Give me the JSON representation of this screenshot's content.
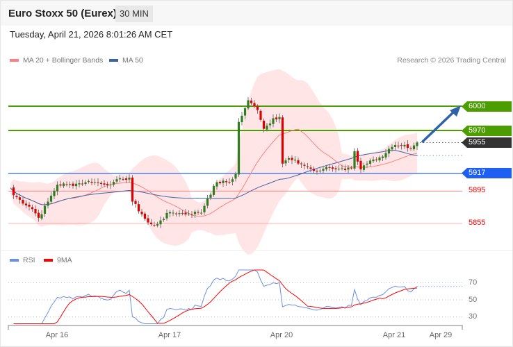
{
  "header": {
    "title": "Euro Stoxx 50 (Eurex)",
    "timeframe": "30 MIN",
    "datetime": "Tuesday, April 21, 2026 8:01:26 AM CET"
  },
  "legend": {
    "ma20": "MA 20 + Bollinger Bands",
    "ma50": "MA 50",
    "credit": "Research © 2026 Trading Central",
    "rsi": "RSI",
    "rsi_ma": "9MA"
  },
  "colors": {
    "up": "#2e7d1e",
    "down": "#e00000",
    "ma20": "#ff8080",
    "ma50": "#3a64a8",
    "band": "#ffe0e0",
    "resistance": "#4c9d00",
    "support": "#1e5ef0",
    "current": "#333333",
    "rsi": "#6b8ee8",
    "rsi_ma": "#ff0000"
  },
  "levels": [
    {
      "value": 6000,
      "label": "6000",
      "type": "resistance"
    },
    {
      "value": 5970,
      "label": "5970",
      "type": "resistance"
    },
    {
      "value": 5955,
      "label": "5955",
      "type": "current"
    },
    {
      "value": 5917,
      "label": "5917",
      "type": "support"
    },
    {
      "value": 5895,
      "label": "5895",
      "type": "minor"
    },
    {
      "value": 5855,
      "label": "5855",
      "type": "minor"
    }
  ],
  "rsi_ticks": [
    "70",
    "50",
    "30"
  ],
  "dates": [
    "Apr 16",
    "Apr 17",
    "Apr 20",
    "Apr 21",
    "Apr 29"
  ],
  "chart_data": {
    "type": "candlestick",
    "title": "Euro Stoxx 50 (Eurex) 30 MIN",
    "target": 6000,
    "price_path": [
      [
        0,
        5899
      ],
      [
        1,
        5890
      ],
      [
        7,
        5873
      ],
      [
        9,
        5862
      ],
      [
        11,
        5875
      ],
      [
        15,
        5903
      ],
      [
        19,
        5903
      ],
      [
        26,
        5907
      ],
      [
        30,
        5903
      ],
      [
        38,
        5912
      ],
      [
        39,
        5882
      ],
      [
        44,
        5856
      ],
      [
        46,
        5852
      ],
      [
        51,
        5869
      ],
      [
        56,
        5867
      ],
      [
        61,
        5869
      ],
      [
        63,
        5886
      ],
      [
        66,
        5906
      ],
      [
        70,
        5906
      ],
      [
        72,
        5916
      ],
      [
        73,
        5980
      ],
      [
        76,
        6006
      ],
      [
        79,
        5997
      ],
      [
        81,
        5972
      ],
      [
        84,
        5985
      ],
      [
        86,
        5987
      ],
      [
        87,
        5929
      ],
      [
        89,
        5935
      ],
      [
        95,
        5925
      ],
      [
        98,
        5918
      ],
      [
        101,
        5925
      ],
      [
        106,
        5922
      ],
      [
        109,
        5925
      ],
      [
        110,
        5943
      ],
      [
        112,
        5920
      ],
      [
        114,
        5929
      ],
      [
        119,
        5937
      ],
      [
        122,
        5952
      ],
      [
        126,
        5952
      ],
      [
        128,
        5948
      ],
      [
        130,
        5955
      ]
    ]
  }
}
